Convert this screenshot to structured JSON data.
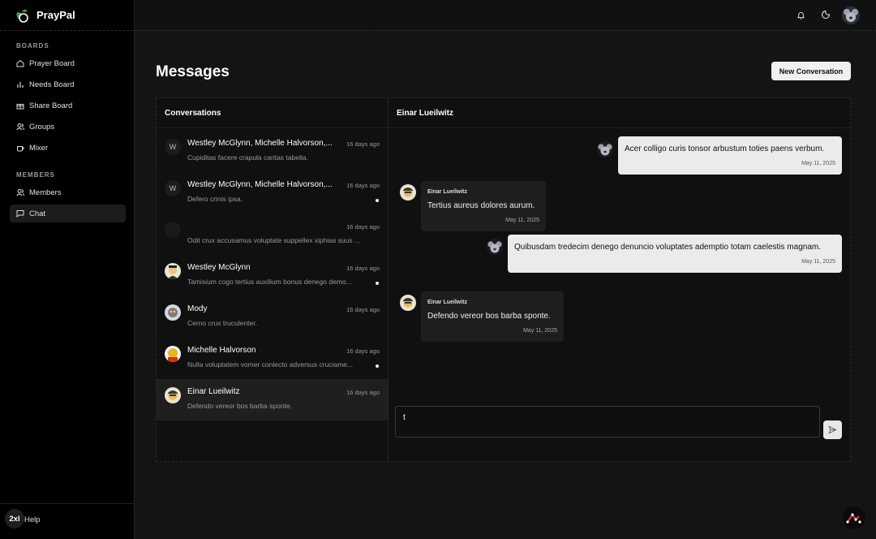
{
  "app": {
    "name": "PrayPal"
  },
  "sidebar": {
    "boards_label": "BOARDS",
    "boards": [
      {
        "label": "Prayer Board",
        "icon": "home-icon"
      },
      {
        "label": "Needs Board",
        "icon": "bar-chart-icon"
      },
      {
        "label": "Share Board",
        "icon": "gift-icon"
      },
      {
        "label": "Groups",
        "icon": "users-icon"
      },
      {
        "label": "Mixer",
        "icon": "cup-icon"
      }
    ],
    "members_label": "MEMBERS",
    "members": [
      {
        "label": "Members",
        "icon": "users-icon"
      },
      {
        "label": "Chat",
        "icon": "chat-icon",
        "active": true
      }
    ],
    "footer": {
      "badge": "2xl",
      "help": "Help"
    }
  },
  "page": {
    "title": "Messages",
    "new_conversation": "New Conversation"
  },
  "conversations": {
    "heading": "Conversations",
    "items": [
      {
        "initial": "W",
        "name": "Westley McGlynn, Michelle Halvorson,...",
        "time": "16 days ago",
        "preview": "Cupiditas facere crapula caritas tabella.",
        "unread": false
      },
      {
        "initial": "W",
        "name": "Westley McGlynn, Michelle Halvorson,...",
        "time": "16 days ago",
        "preview": "Defero crinis ipsa.",
        "unread": true
      },
      {
        "initial": "",
        "name": "",
        "time": "16 days ago",
        "preview": "Odit crux accusamus voluptate suppellex xiphias suus ...",
        "unread": false
      },
      {
        "initial": "",
        "name": "Westley McGlynn",
        "time": "16 days ago",
        "preview": "Tamisium cogo tertius auxilium bonus denego demo...",
        "unread": true
      },
      {
        "initial": "",
        "name": "Mody",
        "time": "16 days ago",
        "preview": "Cerno crux truculenter.",
        "unread": false
      },
      {
        "initial": "",
        "name": "Michelle Halvorson",
        "time": "16 days ago",
        "preview": "Nulla voluptatem vomer conlecto adversus cruciame...",
        "unread": true
      },
      {
        "initial": "",
        "name": "Einar Lueilwitz",
        "time": "16 days ago",
        "preview": "Defendo vereor bos barba sponte.",
        "unread": false,
        "active": true
      }
    ]
  },
  "chat": {
    "heading": "Einar Lueilwitz",
    "messages": [
      {
        "from": "me",
        "text": "Acer colligo curis tonsor arbustum toties paens verbum.",
        "time": "May 11, 2025"
      },
      {
        "from": "them",
        "sender": "Einar Lueilwitz",
        "text": "Tertius aureus dolores aurum.",
        "time": "May 11, 2025"
      },
      {
        "from": "me",
        "text": "Quibusdam tredecim denego denuncio voluptates ademptio totam caelestis magnam.",
        "time": "May 11, 2025"
      },
      {
        "from": "them",
        "sender": "Einar Lueilwitz",
        "text": "Defendo vereor bos barba sponte.",
        "time": "May 11, 2025"
      }
    ],
    "input_value": "t"
  }
}
